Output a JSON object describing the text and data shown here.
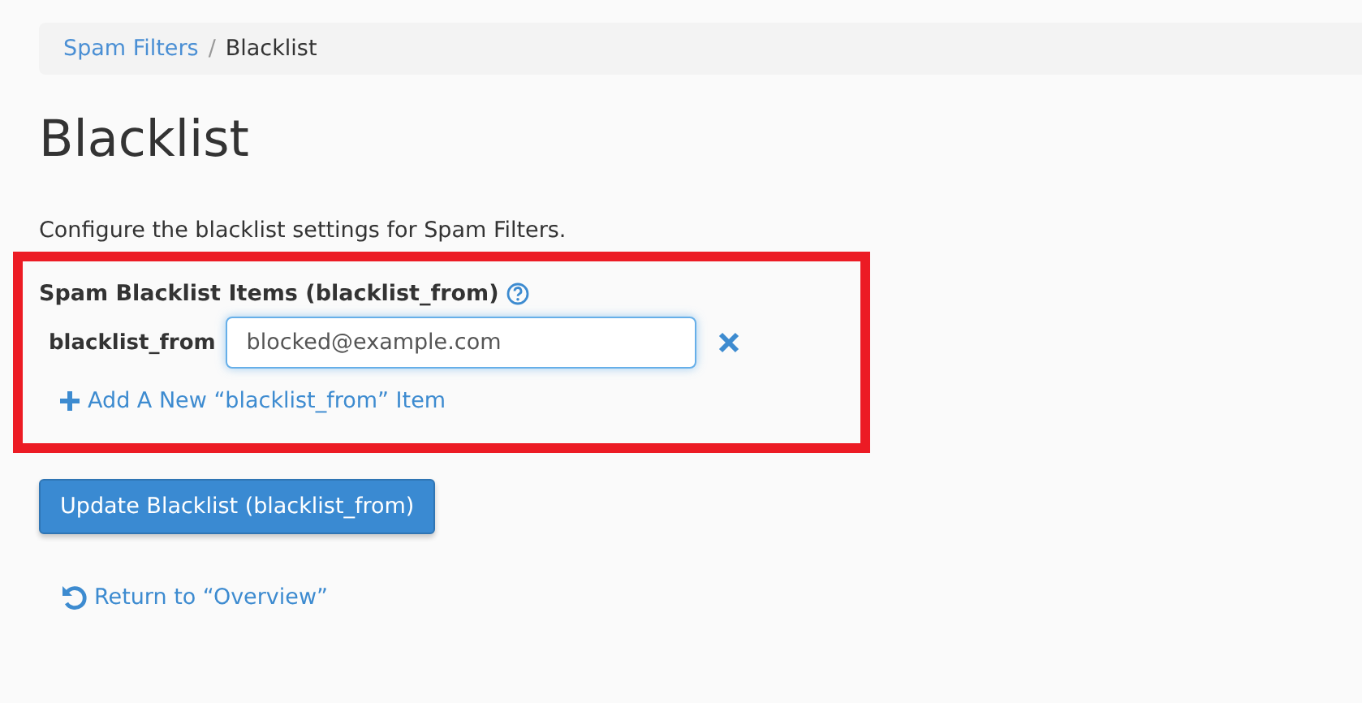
{
  "breadcrumb_separator": "/",
  "breadcrumb": [
    {
      "label": "Spam Filters",
      "kind": "link"
    },
    {
      "label": "Blacklist",
      "kind": "current"
    }
  ],
  "title": "Blacklist",
  "description": "Configure the blacklist settings for Spam Filters.",
  "section": {
    "label": "Spam Blacklist Items (blacklist_from)",
    "highlighted": true,
    "items": [
      {
        "label": "blacklist_from",
        "value": "blocked@example.com",
        "focused": true
      }
    ],
    "add_link": "Add A New “blacklist_from” Item"
  },
  "submit_button": "Update Blacklist (blacklist_from)",
  "return_link": "Return to “Overview”"
}
